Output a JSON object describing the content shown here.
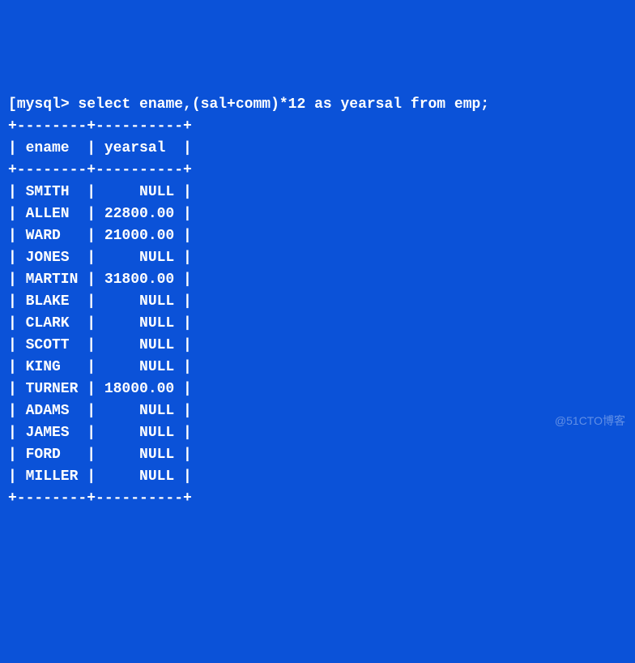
{
  "prompt": "mysql>",
  "command": " select ename,(sal+comm)*12 as yearsal from emp;",
  "border_top": "+--------+----------+",
  "header": "| ename  | yearsal  |",
  "border_mid": "+--------+----------+",
  "rows": [
    "| SMITH  |     NULL |",
    "| ALLEN  | 22800.00 |",
    "| WARD   | 21000.00 |",
    "| JONES  |     NULL |",
    "| MARTIN | 31800.00 |",
    "| BLAKE  |     NULL |",
    "| CLARK  |     NULL |",
    "| SCOTT  |     NULL |",
    "| KING   |     NULL |",
    "| TURNER | 18000.00 |",
    "| ADAMS  |     NULL |",
    "| JAMES  |     NULL |",
    "| FORD   |     NULL |",
    "| MILLER |     NULL |"
  ],
  "border_bot": "+--------+----------+",
  "watermark": "@51CTO博客",
  "chart_data": {
    "type": "table",
    "columns": [
      "ename",
      "yearsal"
    ],
    "data": [
      {
        "ename": "SMITH",
        "yearsal": null
      },
      {
        "ename": "ALLEN",
        "yearsal": 22800.0
      },
      {
        "ename": "WARD",
        "yearsal": 21000.0
      },
      {
        "ename": "JONES",
        "yearsal": null
      },
      {
        "ename": "MARTIN",
        "yearsal": 31800.0
      },
      {
        "ename": "BLAKE",
        "yearsal": null
      },
      {
        "ename": "CLARK",
        "yearsal": null
      },
      {
        "ename": "SCOTT",
        "yearsal": null
      },
      {
        "ename": "KING",
        "yearsal": null
      },
      {
        "ename": "TURNER",
        "yearsal": 18000.0
      },
      {
        "ename": "ADAMS",
        "yearsal": null
      },
      {
        "ename": "JAMES",
        "yearsal": null
      },
      {
        "ename": "FORD",
        "yearsal": null
      },
      {
        "ename": "MILLER",
        "yearsal": null
      }
    ]
  }
}
